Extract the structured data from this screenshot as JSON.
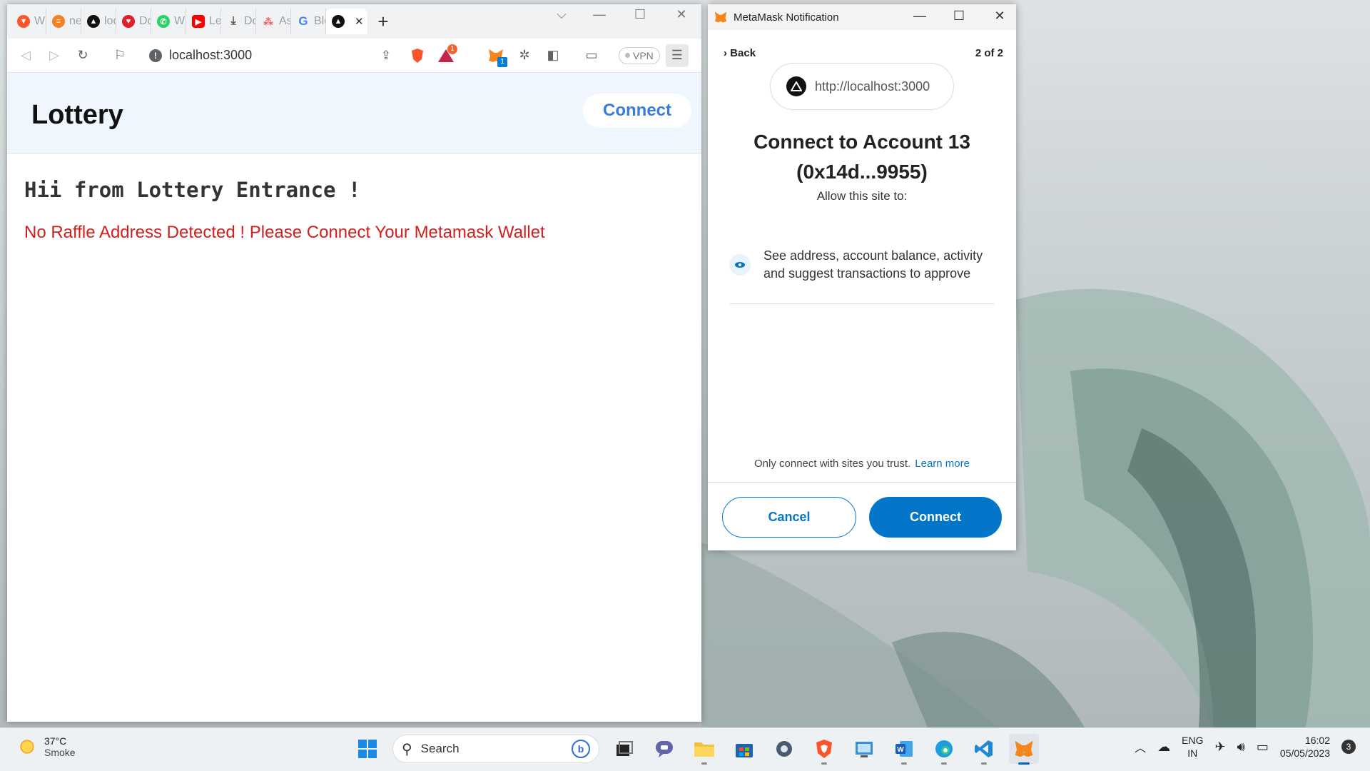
{
  "browser": {
    "tabs": [
      {
        "label": "Wh",
        "icon": "brave-icon",
        "color": "#fb542b"
      },
      {
        "label": "nex",
        "icon": "stackoverflow-icon",
        "color": "#f48024"
      },
      {
        "label": "loca",
        "icon": "triangle-icon",
        "color": "#111111"
      },
      {
        "label": "Dov",
        "icon": "heart-icon",
        "color": "#e0202a"
      },
      {
        "label": "Wh",
        "icon": "whatsapp-icon",
        "color": "#25d366"
      },
      {
        "label": "Lea",
        "icon": "youtube-icon",
        "color": "#ff0000"
      },
      {
        "label": "Dov",
        "icon": "download-icon",
        "color": "#555555"
      },
      {
        "label": "Asa",
        "icon": "asana-icon",
        "color": "#f06a6a"
      },
      {
        "label": "Blo",
        "icon": "google-icon",
        "color": "#4285f4"
      }
    ],
    "active_tab_close": "✕",
    "new_tab": "+",
    "url": "localhost:3000",
    "vpn_label": "VPN",
    "extension_badge": "1"
  },
  "site": {
    "title": "Lottery",
    "connect_label": "Connect",
    "greeting": "Hii from Lottery Entrance !",
    "warning": "No Raffle Address Detected ! Please Connect Your Metamask Wallet"
  },
  "metamask": {
    "window_title": "MetaMask Notification",
    "back_label": "Back",
    "step": "2 of 2",
    "origin": "http://localhost:3000",
    "heading_line1": "Connect to Account 13",
    "heading_line2": "(0x14d...9955)",
    "allow_label": "Allow this site to:",
    "permission": "See address, account balance, activity and suggest transactions to approve",
    "trust_text": "Only connect with sites you trust.",
    "learn_more": "Learn more",
    "cancel_label": "Cancel",
    "connect_label": "Connect",
    "accent": "#0376c9"
  },
  "taskbar": {
    "weather_temp": "37°C",
    "weather_desc": "Smoke",
    "search_label": "Search",
    "lang_line1": "ENG",
    "lang_line2": "IN",
    "time": "16:02",
    "date": "05/05/2023",
    "notification_count": "3"
  }
}
